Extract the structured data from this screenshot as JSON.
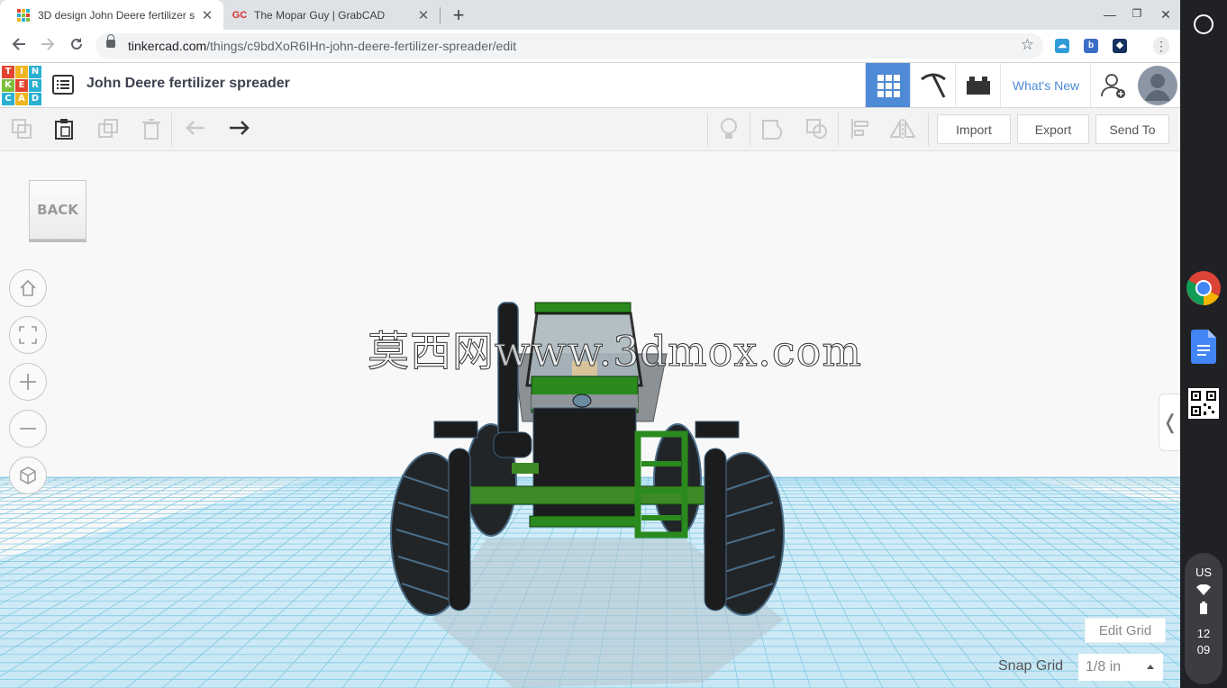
{
  "browser": {
    "tabs": [
      {
        "title": "3D design John Deere fertilizer s",
        "favicon": "tinkercad-icon",
        "active": true
      },
      {
        "title": "The Mopar Guy | GrabCAD",
        "favicon": "GC",
        "active": false
      }
    ],
    "url_domain": "tinkercad.com",
    "url_path": "/things/c9bdXoR6IHn-john-deere-fertilizer-spreader/edit"
  },
  "header": {
    "logo_letters": [
      "T",
      "I",
      "N",
      "K",
      "E",
      "R",
      "C",
      "A",
      "D"
    ],
    "design_title": "John Deere fertilizer spreader",
    "whats_new": "What's New"
  },
  "toolbar": {
    "import_label": "Import",
    "export_label": "Export",
    "sendto_label": "Send To"
  },
  "workplane": {
    "viewcube_label": "BACK",
    "edit_grid": "Edit Grid",
    "snap_grid_label": "Snap Grid",
    "snap_grid_value": "1/8 in",
    "watermark": "莫西网www.3dmox.com"
  },
  "shelf": {
    "locale": "US",
    "time_hour": "12",
    "time_min": "09"
  },
  "colors": {
    "accent": "#4f8ad6",
    "grid": "#5bb8db",
    "tractor_green": "#2a8a1e",
    "tractor_body": "#1b1c1e"
  }
}
